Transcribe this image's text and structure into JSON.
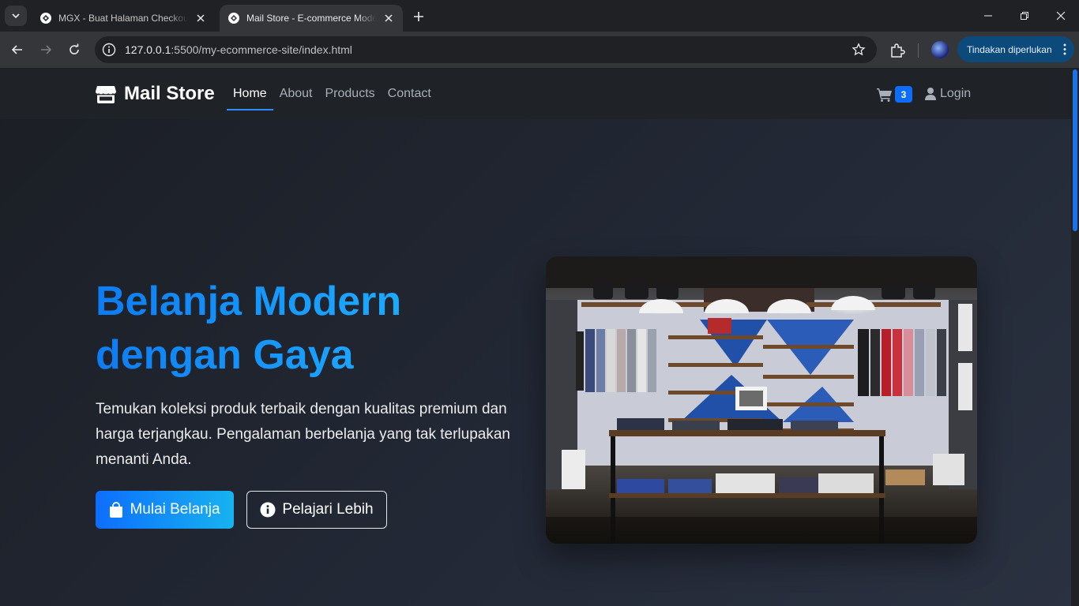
{
  "browser": {
    "tabs": [
      {
        "title": "MGX - Buat Halaman Checkout",
        "active": false
      },
      {
        "title": "Mail Store - E-commerce Modern",
        "active": true
      }
    ],
    "url_host": "127.0.0.1",
    "url_rest": ":5500/my-ecommerce-site/index.html",
    "action_pill": "Tindakan diperlukan"
  },
  "navbar": {
    "brand": "Mail Store",
    "links": [
      {
        "label": "Home",
        "active": true
      },
      {
        "label": "About",
        "active": false
      },
      {
        "label": "Products",
        "active": false
      },
      {
        "label": "Contact",
        "active": false
      }
    ],
    "cart_count": "3",
    "login_label": "Login"
  },
  "hero": {
    "title_line1": "Belanja Modern",
    "title_line2": "dengan Gaya",
    "description": "Temukan koleksi produk terbaik dengan kualitas premium dan harga terjangkau. Pengalaman berbelanja yang tak terlupakan menanti Anda.",
    "primary_button": "Mulai Belanja",
    "secondary_button": "Pelajari Lebih"
  },
  "colors": {
    "accent": "#0d6efd",
    "accent_light": "#1fb7f5",
    "page_bg": "#1f2227"
  }
}
